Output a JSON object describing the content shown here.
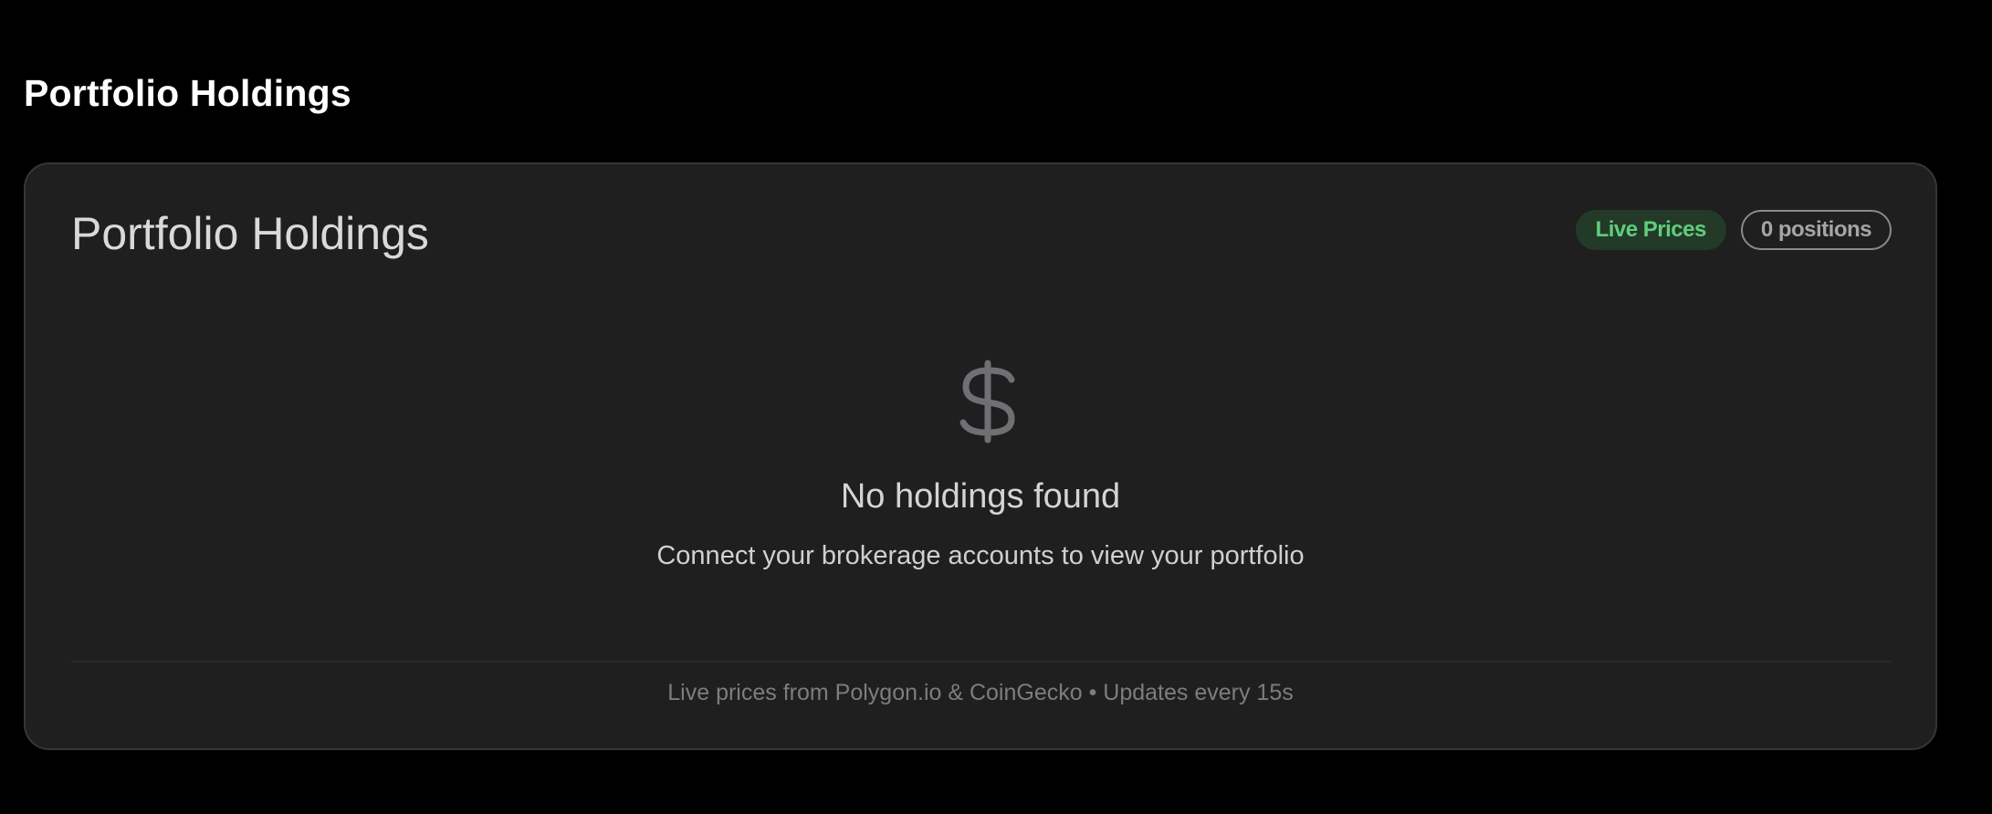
{
  "page": {
    "title": "Portfolio Holdings"
  },
  "card": {
    "title": "Portfolio Holdings",
    "badges": {
      "live_prices": "Live Prices",
      "positions": "0 positions"
    },
    "empty_state": {
      "icon": "dollar-sign-icon",
      "title": "No holdings found",
      "subtitle": "Connect your brokerage accounts to view your portfolio"
    },
    "footer": "Live prices from Polygon.io & CoinGecko • Updates every 15s"
  },
  "colors": {
    "background": "#000000",
    "card_background": "#1f1f1f",
    "card_border": "#363636",
    "live_badge_bg": "#243a29",
    "live_badge_text": "#5fce7b",
    "positions_badge_border": "#8a8a8a",
    "icon": "#6f6f74"
  }
}
